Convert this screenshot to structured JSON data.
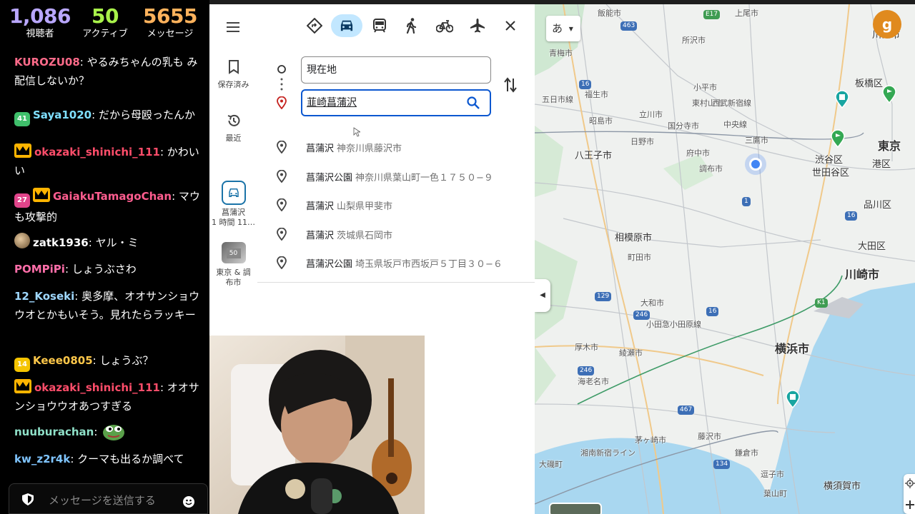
{
  "chat": {
    "stats": {
      "viewers": {
        "value": "1,086",
        "label": "視聴者"
      },
      "active": {
        "value": "50",
        "label": "アクティブ"
      },
      "messages": {
        "value": "5655",
        "label": "メッセージ"
      }
    },
    "messages": [
      {
        "user": "KUROZU08",
        "user_color": "#ff6b8a",
        "badge": "",
        "text": ": やるみちゃんの乳も み配信しないか？"
      },
      {
        "user": "Saya1020",
        "user_color": "#7fe0ff",
        "badge": "41",
        "badge_color": "#3fbf6b",
        "text": ": だから母殴ったんか"
      },
      {
        "user": "okazaki_shinichi_111",
        "user_color": "#ff4d6a",
        "badge": "crown",
        "text": ": かわいい"
      },
      {
        "user": "GaiakuTamagoChan",
        "user_color": "#ff5d8f",
        "badge": "27",
        "badge_color": "#e0448a",
        "badge2": "crown",
        "text": ": マウも攻撃的"
      },
      {
        "user": "zatk1936",
        "user_color": "#ffffff",
        "badge": "avatar",
        "text": ": ヤル・ミ"
      },
      {
        "user": "POMPiPi",
        "user_color": "#ff6ea9",
        "badge": "",
        "text": ": しょうぶさわ"
      },
      {
        "user": "12_Koseki",
        "user_color": "#9fd8ff",
        "badge": "",
        "text": ": 奥多摩、オオサンショウウオとかもいそう。見れたらラッキー"
      },
      {
        "user": "Keee0805",
        "user_color": "#ffc84a",
        "badge": "14",
        "badge_color": "#f5c400",
        "text": ": しょうぶ？"
      },
      {
        "user": "okazaki_shinichi_111",
        "user_color": "#ff4d6a",
        "badge": "crown",
        "text": ": オオサンショウウオあつすぎる"
      },
      {
        "user": "nuuburachan",
        "user_color": "#8fe0c8",
        "badge": "",
        "text": ":",
        "emote": "pepe-emote"
      },
      {
        "user": "kw_z2r4k",
        "user_color": "#7fc4ff",
        "badge": "",
        "text": ": クーマも出るか調べて"
      }
    ],
    "input_placeholder": "メッセージを送信する"
  },
  "maps": {
    "rail": {
      "saved_label": "保存済み",
      "recent_label": "最近",
      "recent_trip_label1": "菖蒲沢",
      "recent_trip_label2": "1 時間 11…",
      "recent_place_label1": "東京 & 調",
      "recent_place_label2": "布市"
    },
    "modes": [
      "best-route",
      "car",
      "transit",
      "walk",
      "bicycle",
      "flight"
    ],
    "active_mode": "car",
    "origin_value": "現在地",
    "destination_value": "韮崎菖蒲沢",
    "suggestions": [
      {
        "name": "菖蒲沢",
        "detail": "神奈川県藤沢市"
      },
      {
        "name": "菖蒲沢公園",
        "detail": "神奈川県葉山町一色１７５０−９"
      },
      {
        "name": "菖蒲沢",
        "detail": "山梨県甲斐市"
      },
      {
        "name": "菖蒲沢",
        "detail": "茨城県石岡市"
      },
      {
        "name": "菖蒲沢公園",
        "detail": "埼玉県坂戸市西坂戸５丁目３０−６"
      }
    ],
    "map_labels": {
      "tokyo": "東京",
      "kawaguchi": "川口市",
      "itabashi": "板橋区",
      "shibuya": "渋谷区",
      "setagaya": "世田谷区",
      "minato": "港区",
      "shinagawa": "品川区",
      "ota": "大田区",
      "kawasaki": "川崎市",
      "yokohama": "横浜市",
      "sagamihara": "相模原市",
      "hachioji": "八王子市",
      "tachikawa": "立川市",
      "fuchu": "府中市",
      "chofu": "調布市",
      "mitaka": "三鷹市",
      "tokorozawa": "所沢市",
      "higashimurayama": "東村山市",
      "kodaira": "小平市",
      "kokubunji": "国分寺市",
      "hino": "日野市",
      "akishima": "昭島市",
      "fussa": "福生市",
      "ome": "青梅市",
      "itsukaichi": "五日市線",
      "seibu": "西武新宿線",
      "chuo": "中央線",
      "machida": "町田市",
      "yamato": "大和市",
      "atsugi": "厚木市",
      "ayase": "綾瀬市",
      "ebina": "海老名市",
      "fujisawa": "藤沢市",
      "kamakura": "鎌倉市",
      "zushi": "逗子市",
      "hayama": "葉山町",
      "yokosuka": "横須賀市",
      "chigasaki": "茅ヶ崎市",
      "isobe": "大磯町",
      "shonan": "湘南新宿ライン",
      "odakyu": "小田急小田原線",
      "hannou": "飯能市",
      "ageo": "上尾市",
      "r16a": "16",
      "r16b": "16",
      "r16c": "16",
      "r129": "129",
      "r246a": "246",
      "r246b": "246",
      "r134": "134",
      "r467": "467",
      "r463": "463",
      "r1": "1",
      "k1": "K1",
      "e17": "E17",
      "lang_button": "あ"
    }
  }
}
